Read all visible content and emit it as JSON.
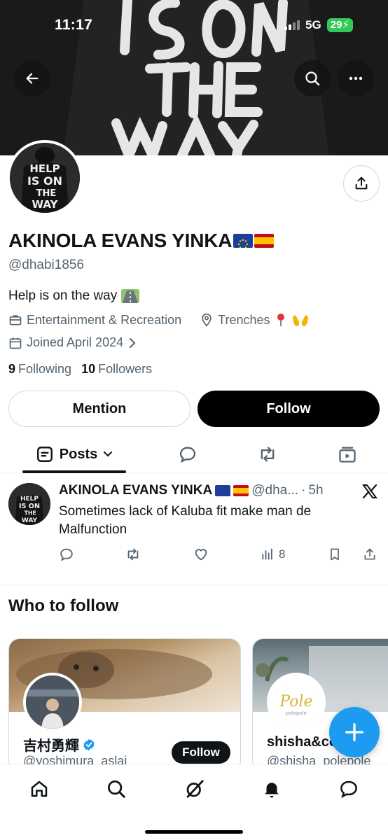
{
  "status_bar": {
    "time": "11:17",
    "network": "5G",
    "battery": "29"
  },
  "banner": {
    "art_text": [
      "IS ON",
      "THE",
      "WAY"
    ]
  },
  "profile": {
    "avatar_text": [
      "HELP",
      "IS ON",
      "THE",
      "WAY"
    ],
    "name": "AKINOLA EVANS YINKA",
    "name_flags": [
      "flag-eu-icon",
      "flag-spain-icon"
    ],
    "handle": "@dhabi1856",
    "bio": "Help is on the way",
    "bio_emoji": "motorway-icon",
    "category": "Entertainment & Recreation",
    "location": "Trenches",
    "location_emojis": [
      "round-pushpin-icon",
      "open-hands-icon"
    ],
    "joined": "Joined April 2024",
    "following_count": "9",
    "following_label": "Following",
    "followers_count": "10",
    "followers_label": "Followers",
    "mention_label": "Mention",
    "follow_label": "Follow"
  },
  "tabs": {
    "posts_label": "Posts"
  },
  "post": {
    "name": "AKINOLA EVANS YINKA",
    "handle": "@dha...",
    "separator": "·",
    "time": "5h",
    "text": "Sometimes lack of Kaluba fit make man de Malfunction",
    "views": "8"
  },
  "who_to_follow": {
    "title": "Who to follow",
    "cards": [
      {
        "name": "吉村勇輝",
        "verified": true,
        "handle": "@yoshimura_aslai",
        "follow_label": "Follow"
      },
      {
        "name": "shisha&co...ol",
        "handle": "@shisha_polepole",
        "avatar_text": "Pole",
        "avatar_subtext": "polepole"
      }
    ]
  },
  "colors": {
    "accent": "#1d9bf0",
    "text": "#0f1419",
    "secondary": "#536471",
    "border": "#cfd9de"
  }
}
